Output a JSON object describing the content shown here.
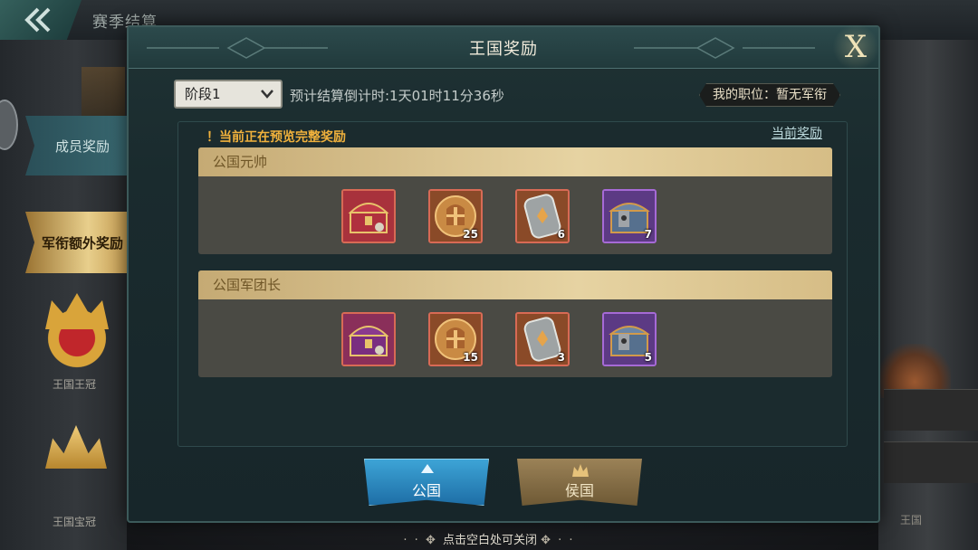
{
  "background": {
    "title": "赛季结算",
    "side_label_a": "王国王冠",
    "side_label_b": "王国宝冠",
    "right_label": "王国"
  },
  "side_tabs": {
    "members": "成员奖励",
    "rank_extra": "军衔额外奖励"
  },
  "panel": {
    "title": "王国奖励",
    "close_label": "X"
  },
  "stage_select": {
    "value": "阶段1"
  },
  "countdown": "预计结算倒计时:1天01时11分36秒",
  "position_badge": "我的职位：暂无军衔",
  "preview_note": "！当前正在预览完整奖励",
  "current_rewards_link": "当前奖励",
  "tiers": [
    {
      "title": "公国元帅",
      "items": [
        {
          "icon": "red-chest-icon",
          "count": ""
        },
        {
          "icon": "gold-helmet-icon",
          "count": "25"
        },
        {
          "icon": "stone-tablet-icon",
          "count": "6"
        },
        {
          "icon": "armor-chest-icon",
          "count": "7"
        }
      ]
    },
    {
      "title": "公国军团长",
      "items": [
        {
          "icon": "purple-chest-icon",
          "count": ""
        },
        {
          "icon": "gold-helmet-icon",
          "count": "15"
        },
        {
          "icon": "stone-tablet-icon",
          "count": "3"
        },
        {
          "icon": "armor-chest-icon",
          "count": "5"
        }
      ]
    }
  ],
  "kingdom_tabs": {
    "duchy": "公国",
    "marquis": "侯国"
  },
  "close_hint": "点击空白处可关闭",
  "colors": {
    "accent_gold": "#e6d3a2",
    "warning": "#f0b13c",
    "duchy_blue": "#3da4d6"
  }
}
